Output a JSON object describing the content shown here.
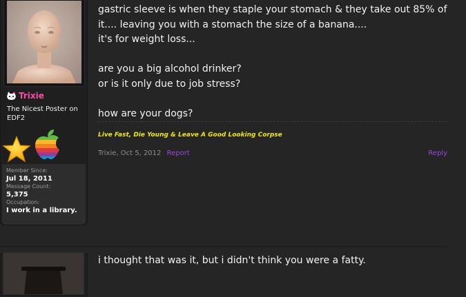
{
  "post1": {
    "user": {
      "name": "Trixie",
      "title": "The Nicest Poster on EDF2",
      "extra": [
        {
          "label": "Member Since:",
          "value": "Jul 18, 2011"
        },
        {
          "label": "Message Count:",
          "value": "5,375"
        },
        {
          "label": "Occupation:",
          "value": "I work in a library."
        }
      ]
    },
    "lines": [
      "gastric sleeve is when they staple your stomach & they take out 85% of it.... leaving you with a stomach the size of a banana....",
      "it's for weight loss...",
      "are you a big alcohol drinker?",
      "or is it only due to job stress?",
      "how are your dogs?"
    ],
    "signature": "Live Fast, Die Young & Leave A Good Looking Corpse",
    "meta": {
      "author": "Trixie",
      "date": "Oct 5, 2012",
      "report": "Report",
      "reply": "Reply"
    }
  },
  "post2": {
    "text": "i thought that was it, but i didn't think you were a fatty."
  },
  "colors": {
    "username": "#ff4aa8",
    "signature": "#f0e800",
    "link": "#9b45e0"
  }
}
